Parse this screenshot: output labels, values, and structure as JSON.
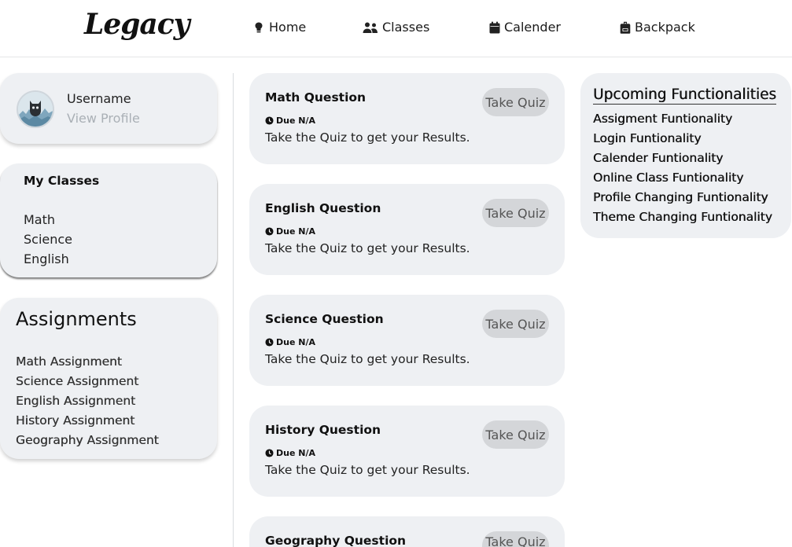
{
  "header": {
    "logo": "Legacy",
    "nav": [
      {
        "label": "Home",
        "icon": "brain-icon"
      },
      {
        "label": "Classes",
        "icon": "users-icon"
      },
      {
        "label": "Calender",
        "icon": "calendar-icon"
      },
      {
        "label": "Backpack",
        "icon": "backpack-icon"
      }
    ]
  },
  "profile": {
    "username": "Username",
    "view_profile": "View Profile"
  },
  "my_classes": {
    "title": "My Classes",
    "items": [
      "Math",
      "Science",
      "English"
    ]
  },
  "assignments": {
    "title": "Assignments",
    "items": [
      "Math Assignment",
      "Science Assignment",
      "English Assignment",
      "History Assignment",
      "Geography Assignment"
    ]
  },
  "quizzes": [
    {
      "title": "Math Question",
      "due": "Due N/A",
      "description": "Take the Quiz to get your Results.",
      "button": "Take Quiz"
    },
    {
      "title": "English Question",
      "due": "Due N/A",
      "description": "Take the Quiz to get your Results.",
      "button": "Take Quiz"
    },
    {
      "title": "Science Question",
      "due": "Due N/A",
      "description": "Take the Quiz to get your Results.",
      "button": "Take Quiz"
    },
    {
      "title": "History Question",
      "due": "Due N/A",
      "description": "Take the Quiz to get your Results.",
      "button": "Take Quiz"
    },
    {
      "title": "Geography Question",
      "due": "",
      "description": "",
      "button": "Take Quiz"
    }
  ],
  "upcoming": {
    "title": "Upcoming Functionalities",
    "items": [
      "Assigment Funtionality",
      "Login Funtionality",
      "Calender Funtionality",
      "Online Class Funtionality",
      "Profile Changing Funtionality",
      "Theme Changing Funtionality"
    ]
  },
  "colors": {
    "card_bg": "#eef0f3",
    "button_bg": "#d4d6d9",
    "muted_text": "#aab0b6"
  }
}
